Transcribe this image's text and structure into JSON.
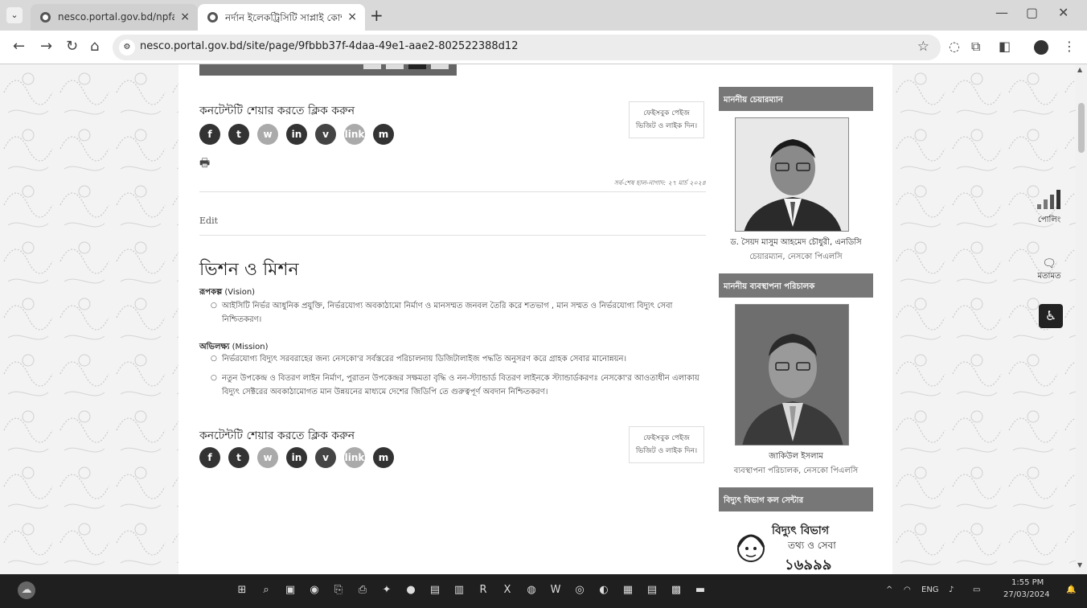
{
  "browser": {
    "tabs": [
      {
        "title": "nesco.portal.gov.bd/npfadmin/",
        "active": false
      },
      {
        "title": "নর্দান ইলেকট্রিসিটি সাপ্লাই কোম্প",
        "active": true
      }
    ],
    "url": "nesco.portal.gov.bd/site/page/9fbbb37f-4daa-49e1-aae2-802522388d12"
  },
  "content": {
    "share_title": "কনটেন্টটি শেয়ার করতে ক্লিক করুন",
    "facebook_box": "ফেইসবুক পেইজ ভিজিট ও লাইক দিন।",
    "social": [
      "f",
      "t",
      "w",
      "in",
      "v",
      "link",
      "m"
    ],
    "last_update": "সর্ব-শেষ হাল-নাগাদ: ২৭ মার্চ ২০২৪",
    "edit": "Edit",
    "heading": "ভিশন ও মিশন",
    "vision_label": "রূপকল্প",
    "vision_en": "(Vision)",
    "vision_items": [
      "আইসিটি নির্ভর আধুনিক প্রযুক্তি, নির্ভরযোগ্য অবকাঠামো নির্মাণ ও মানসম্মত জনবল তৈরি করে শতভাগ , মান সম্মত ও নির্ভরযোগ্য বিদ্যুৎ সেবা নিশ্চিতকরণ।"
    ],
    "mission_label": "অভিলক্ষ্য",
    "mission_en": "(Mission)",
    "mission_items": [
      "নির্ভরযোগ্য বিদ্যুৎ সরবরাহের জন্য নেসকো'র সর্বস্তরের পরিচালনায় ডিজিটালাইজ পদ্ধতি অনুসরণ করে গ্রাহক সেবার মানোন্নয়ন।",
      "নতুন উপকেন্দ্র ও বিতরণ লাইন নির্মাণ, পুরাতন উপকেন্দ্রর সক্ষমতা বৃদ্ধি ও নন-স্ট্যান্ডার্ড বিতরণ লাইনকে স্ট্যান্ডার্ডকরণঃ নেসকো'র আওতাধীন এলাকায় বিদ্যুৎ সেক্টরের অবকাঠামোগত মান উন্নয়নের মাধ্যমে দেশের জিডিপি তে গুরুত্বপূর্ণ অবদান নিশ্চিতকরণ।"
    ]
  },
  "sidebar": {
    "chairman_head": "মাননীয় চেয়ারম্যান",
    "chairman_name": "ড. সৈয়দ মাসুম আহমেদ চৌধুরী, এনডিসি",
    "chairman_title": "চেয়ারম্যান, নেসকো পিএলসি",
    "md_head": "মাননীয় ব্যবস্থাপনা পরিচালক",
    "md_name": "জাকিউল ইসলাম",
    "md_title": "ব্যবস্থাপনা পরিচালক, নেসকো পিএলসি",
    "callcenter_head": "বিদ্যুৎ বিভাগ কল সেন্টার",
    "callcenter_line1": "বিদ্যুৎ বিভাগ",
    "callcenter_line2": "তথ্য ও সেবা",
    "callcenter_number": "১৬৯৯৯"
  },
  "side_widgets": {
    "polling": "পোলিং",
    "opinion": "মতামত"
  },
  "taskbar": {
    "lang": "ENG",
    "time": "1:55 PM",
    "date": "27/03/2024"
  }
}
